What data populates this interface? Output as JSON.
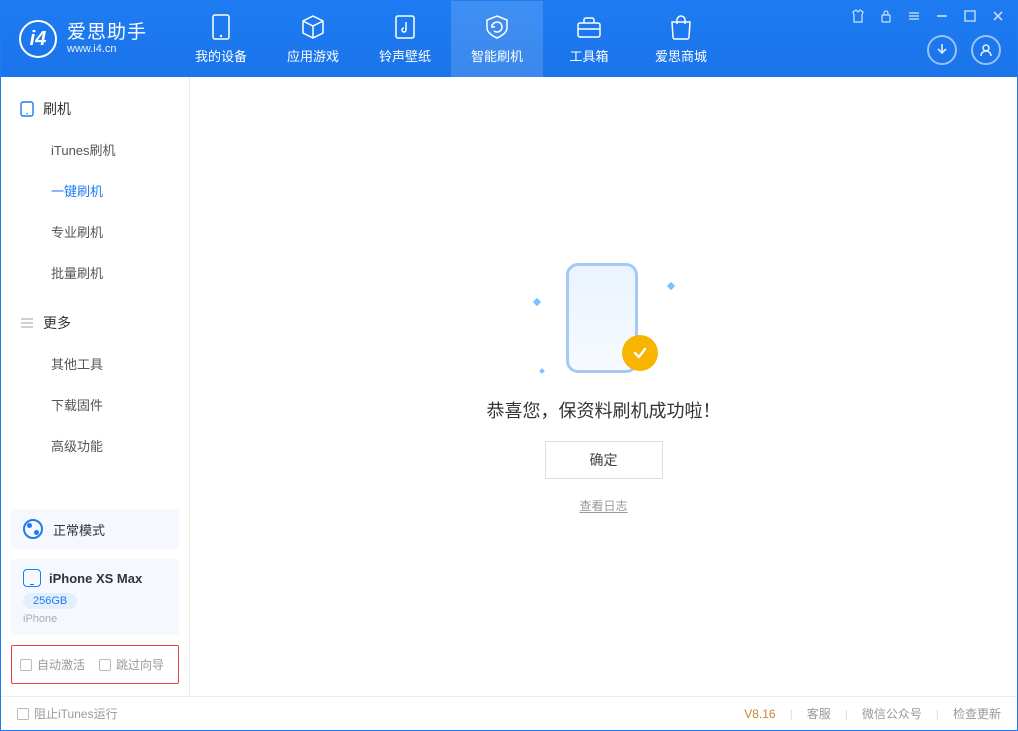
{
  "app": {
    "title": "爱思助手",
    "url": "www.i4.cn"
  },
  "tabs": [
    {
      "label": "我的设备"
    },
    {
      "label": "应用游戏"
    },
    {
      "label": "铃声壁纸"
    },
    {
      "label": "智能刷机"
    },
    {
      "label": "工具箱"
    },
    {
      "label": "爱思商城"
    }
  ],
  "sidebar": {
    "group1_label": "刷机",
    "items1": [
      {
        "label": "iTunes刷机"
      },
      {
        "label": "一键刷机"
      },
      {
        "label": "专业刷机"
      },
      {
        "label": "批量刷机"
      }
    ],
    "group2_label": "更多",
    "items2": [
      {
        "label": "其他工具"
      },
      {
        "label": "下载固件"
      },
      {
        "label": "高级功能"
      }
    ]
  },
  "mode": {
    "label": "正常模式"
  },
  "device": {
    "name": "iPhone XS Max",
    "storage": "256GB",
    "type": "iPhone"
  },
  "options": {
    "auto_activate": "自动激活",
    "skip_guide": "跳过向导"
  },
  "main": {
    "success_text": "恭喜您，保资料刷机成功啦！",
    "ok_label": "确定",
    "log_link": "查看日志"
  },
  "footer": {
    "block_itunes": "阻止iTunes运行",
    "version": "V8.16",
    "link_support": "客服",
    "link_wechat": "微信公众号",
    "link_update": "检查更新"
  }
}
